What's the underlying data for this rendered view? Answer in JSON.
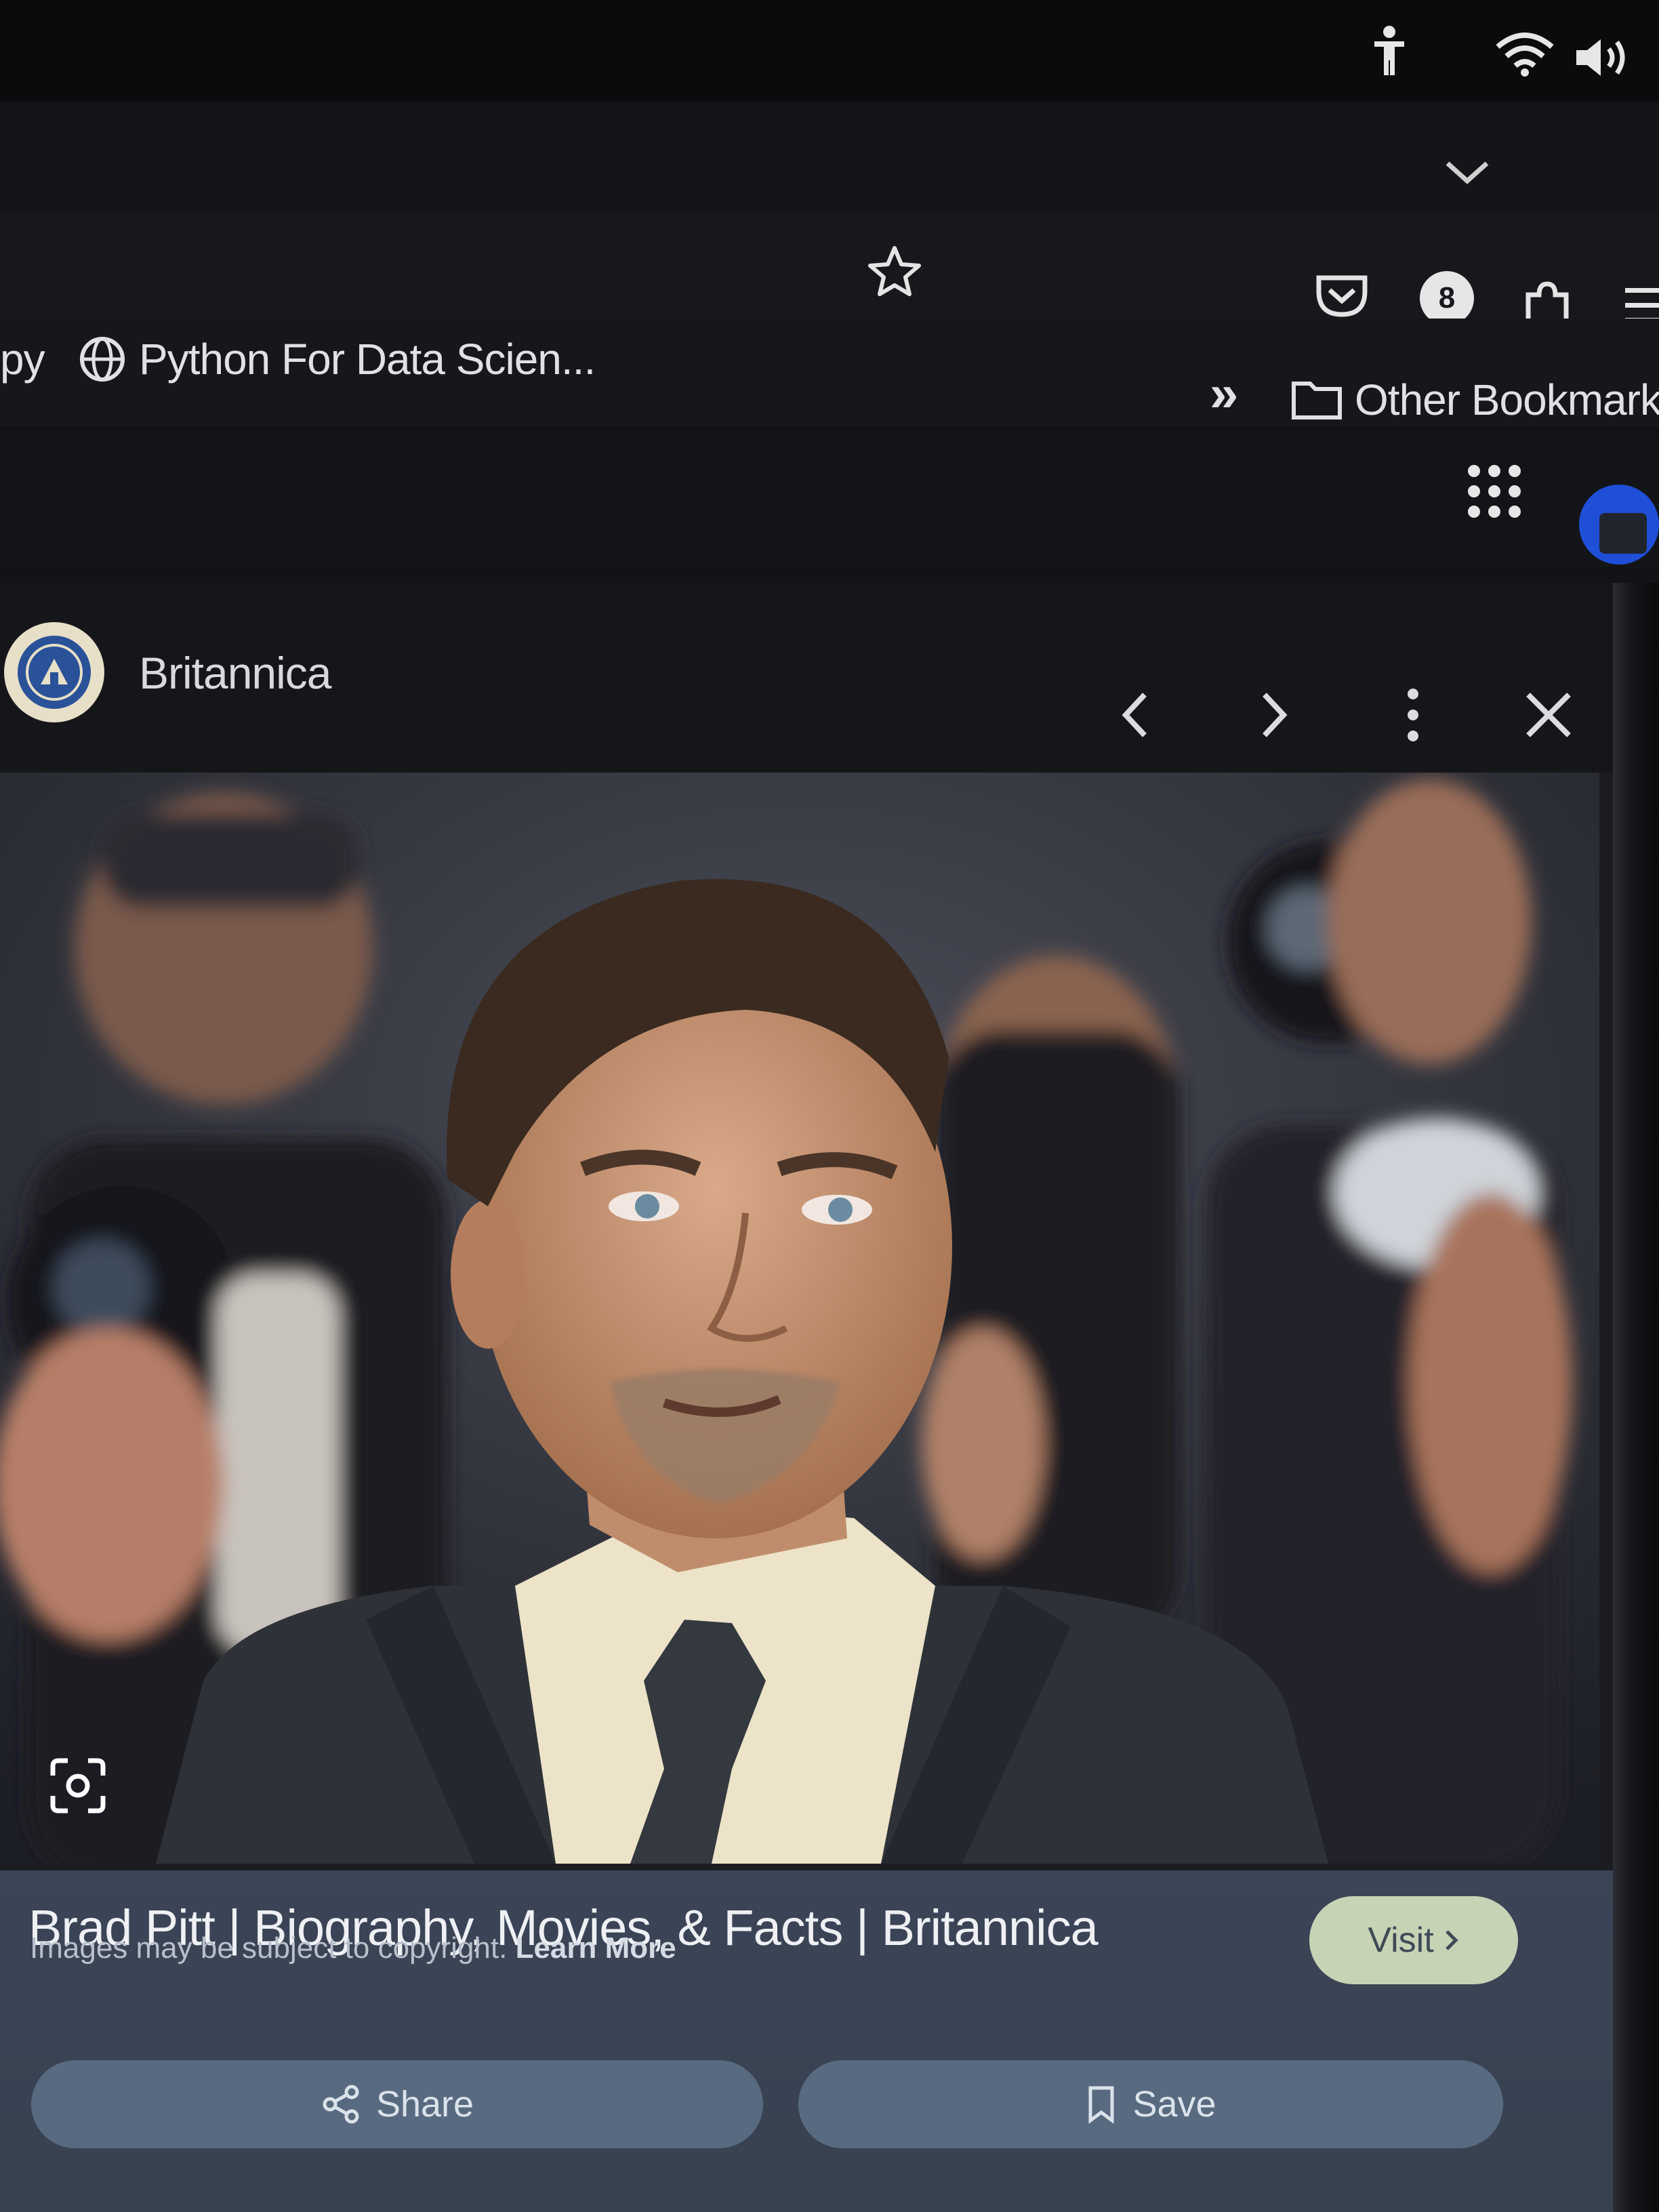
{
  "bookmarks_bar": {
    "partial_item": "py",
    "item_python": "Python For Data Scien...",
    "overflow_glyph": "»",
    "other_bookmarks": "Other Bookmarks"
  },
  "toolbar": {
    "profile_badge": "8"
  },
  "viewer": {
    "source_name": "Britannica",
    "result_title": "Brad Pitt | Biography, Movies, & Facts | Britannica",
    "visit_label": "Visit",
    "copyright_text": "Images may be subject to copyright.",
    "learn_more": "Learn More",
    "share_label": "Share",
    "save_label": "Save"
  },
  "icons": {
    "os_bar": [
      "accessibility-icon",
      "wifi-icon",
      "volume-icon"
    ],
    "browser": [
      "bookmark-star-icon",
      "pocket-icon",
      "extension-icon",
      "menu-icon",
      "globe-icon",
      "folder-icon",
      "chevron-down-icon"
    ],
    "viewer": [
      "previous-icon",
      "next-icon",
      "more-options-icon",
      "close-icon",
      "lens-icon",
      "share-icon",
      "save-icon"
    ]
  },
  "colors": {
    "visit_button": "#c7d3b5",
    "info_panel": "#3b4557",
    "action_button": "#576a80",
    "apps_avatar": "#1f4fd6"
  }
}
